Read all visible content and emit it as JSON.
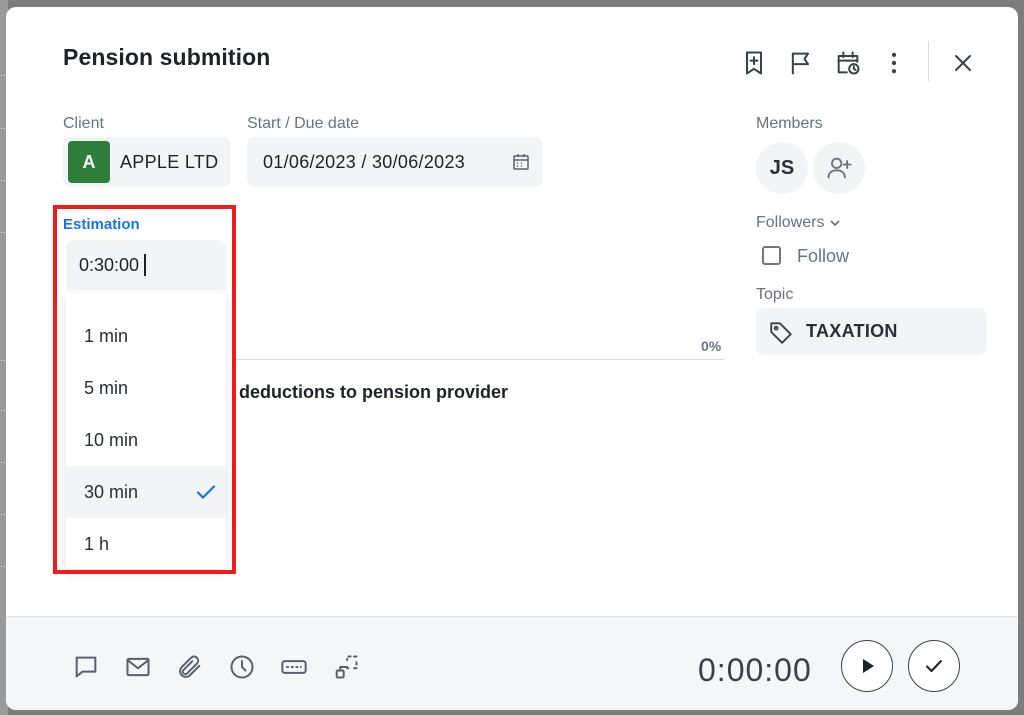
{
  "task": {
    "title": "Pension submition",
    "description": "deductions to pension provider",
    "progress_percent": "0%"
  },
  "client": {
    "label": "Client",
    "initial": "A",
    "name": "APPLE LTD",
    "avatar_color": "#2f7d3a"
  },
  "dates": {
    "label": "Start / Due date",
    "value": "01/06/2023 / 30/06/2023"
  },
  "estimation": {
    "label": "Estimation",
    "value": "0:30:00",
    "options": [
      "1 min",
      "5 min",
      "10 min",
      "30 min",
      "1 h"
    ],
    "selected": "30 min"
  },
  "members": {
    "label": "Members",
    "avatar_initials": "JS"
  },
  "followers": {
    "label": "Followers",
    "follow_label": "Follow",
    "following": false
  },
  "topic": {
    "label": "Topic",
    "value": "TAXATION"
  },
  "footer": {
    "timer": "0:00:00"
  },
  "icons": {
    "header": [
      "bookmark-add-icon",
      "flag-icon",
      "calendar-clock-icon",
      "more-vertical-icon",
      "close-icon"
    ],
    "footer": [
      "comment-icon",
      "mail-icon",
      "attachment-icon",
      "clock-icon",
      "keyboard-icon",
      "subtask-icon",
      "play-icon",
      "check-icon"
    ]
  },
  "colors": {
    "accent": "#1a73e8",
    "highlight": "#ee1d1d"
  }
}
